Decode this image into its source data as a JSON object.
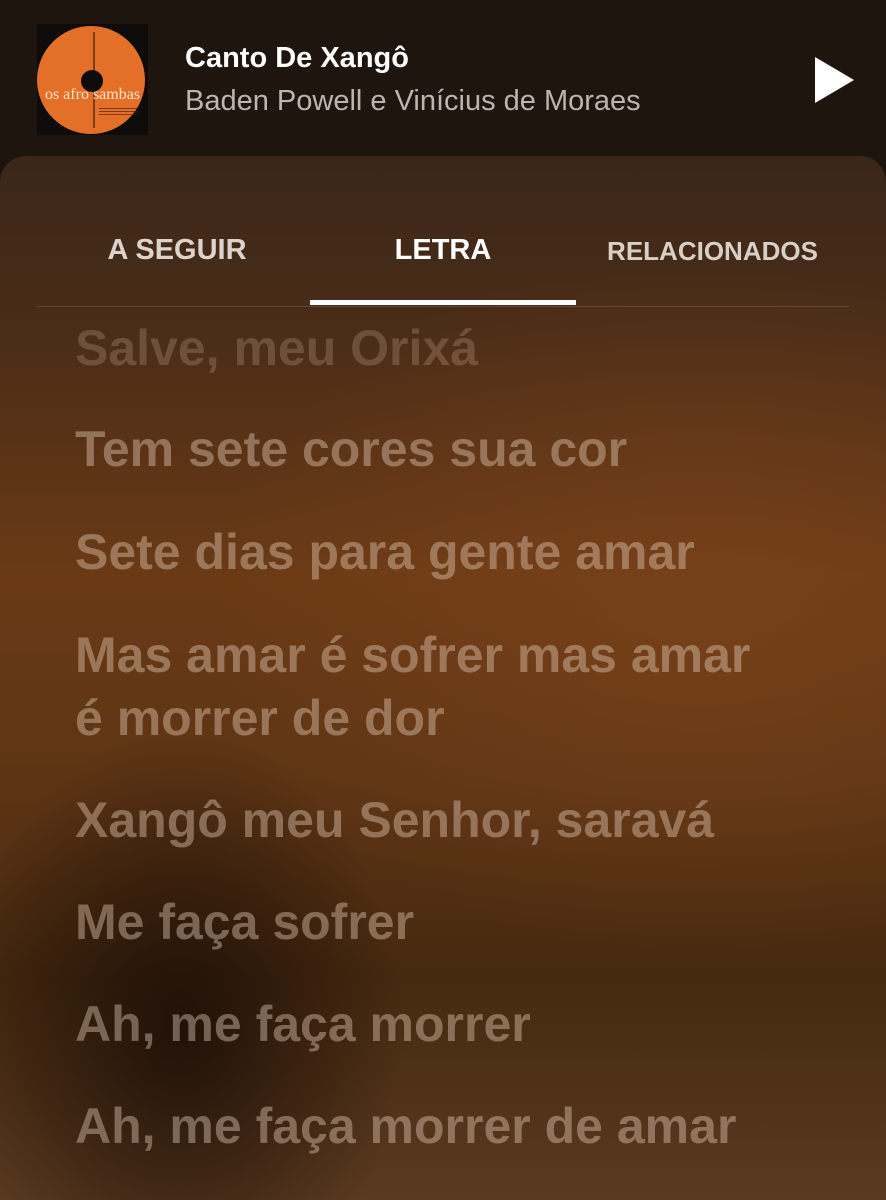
{
  "player": {
    "album_art_text": "os afro sambas",
    "title": "Canto De Xangô",
    "artist": "Baden Powell e Vinícius de Moraes",
    "play_icon": "play-icon"
  },
  "tabs": [
    {
      "label": "A SEGUIR",
      "selected": false
    },
    {
      "label": "LETRA",
      "selected": true
    },
    {
      "label": "RELACIONADOS",
      "selected": false
    }
  ],
  "lyrics": {
    "lines": [
      "Salve, meu Orixá",
      "Tem sete cores sua cor",
      "Sete dias para gente amar",
      "Mas amar é sofrer mas amar",
      "é morrer de dor",
      "Xangô meu Senhor, saravá",
      "Me faça sofrer",
      "Ah, me faça morrer",
      "Ah, me faça morrer de amar"
    ]
  },
  "colors": {
    "accent": "#e46f28",
    "background": "#1e150e",
    "lyric_text": "#e4cdb9"
  }
}
